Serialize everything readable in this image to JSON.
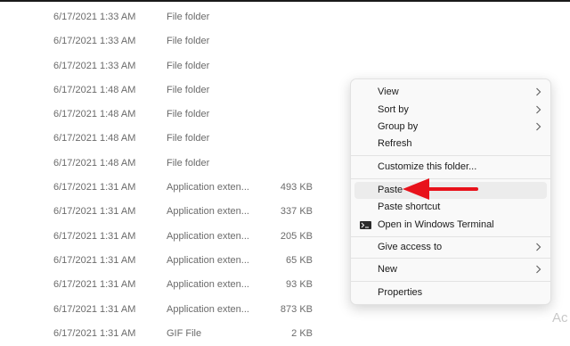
{
  "files": [
    {
      "date": "6/17/2021 1:33 AM",
      "type": "File folder",
      "size": ""
    },
    {
      "date": "6/17/2021 1:33 AM",
      "type": "File folder",
      "size": ""
    },
    {
      "date": "6/17/2021 1:33 AM",
      "type": "File folder",
      "size": ""
    },
    {
      "date": "6/17/2021 1:48 AM",
      "type": "File folder",
      "size": ""
    },
    {
      "date": "6/17/2021 1:48 AM",
      "type": "File folder",
      "size": ""
    },
    {
      "date": "6/17/2021 1:48 AM",
      "type": "File folder",
      "size": ""
    },
    {
      "date": "6/17/2021 1:48 AM",
      "type": "File folder",
      "size": ""
    },
    {
      "date": "6/17/2021 1:31 AM",
      "type": "Application exten...",
      "size": "493 KB"
    },
    {
      "date": "6/17/2021 1:31 AM",
      "type": "Application exten...",
      "size": "337 KB"
    },
    {
      "date": "6/17/2021 1:31 AM",
      "type": "Application exten...",
      "size": "205 KB"
    },
    {
      "date": "6/17/2021 1:31 AM",
      "type": "Application exten...",
      "size": "65 KB"
    },
    {
      "date": "6/17/2021 1:31 AM",
      "type": "Application exten...",
      "size": "93 KB"
    },
    {
      "date": "6/17/2021 1:31 AM",
      "type": "Application exten...",
      "size": "873 KB"
    },
    {
      "date": "6/17/2021 1:31 AM",
      "type": "GIF File",
      "size": "2 KB"
    }
  ],
  "context_menu": {
    "view": "View",
    "sort_by": "Sort by",
    "group_by": "Group by",
    "refresh": "Refresh",
    "customize": "Customize this folder...",
    "paste": "Paste",
    "paste_shortcut": "Paste shortcut",
    "open_terminal": "Open in Windows Terminal",
    "give_access": "Give access to",
    "new": "New",
    "properties": "Properties"
  },
  "watermark": "Ac",
  "colors": {
    "arrow": "#e8121b",
    "menu_bg": "#f9f9f9",
    "highlight": "#ececec"
  }
}
